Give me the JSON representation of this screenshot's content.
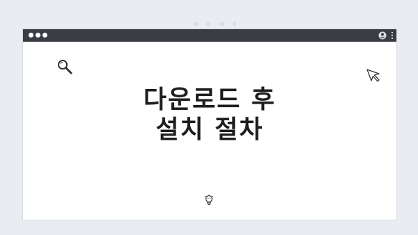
{
  "page": {
    "heading_line1": "다운로드 후",
    "heading_line2": "설치 절차"
  },
  "icons": {
    "top_dots": "four-dots-indicator",
    "window_controls": "three-dots",
    "user": "user-icon",
    "menu": "kebab-menu-icon",
    "search": "search-icon",
    "cursor": "cursor-icon",
    "bulb": "lightbulb-icon"
  },
  "colors": {
    "background": "#e8ecf1",
    "titlebar": "#3a3d43",
    "window": "#ffffff",
    "text": "#1e1e1e"
  }
}
